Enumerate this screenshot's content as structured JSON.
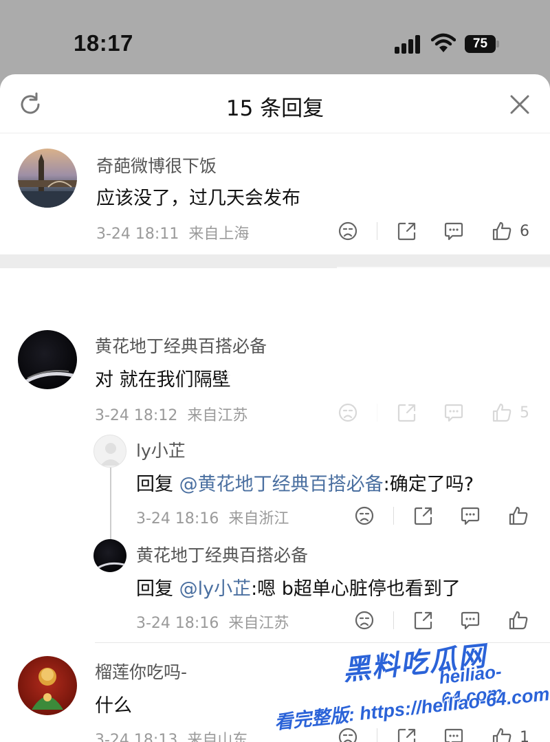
{
  "status_bar": {
    "time": "18:17",
    "battery": "75"
  },
  "sheet": {
    "title": "15 条回复"
  },
  "comments": [
    {
      "name": "奇葩微博很下饭",
      "text": "应该没了，过几天会发布",
      "time": "3-24 18:11",
      "location": "来自上海",
      "likes": "6"
    },
    {
      "name": "黄花地丁经典百搭必备",
      "text": "对 就在我们隔壁",
      "time": "3-24 18:12",
      "location": "来自江苏",
      "likes": "5"
    },
    {
      "name": "榴莲你吃吗-",
      "text": "什么",
      "time": "3-24 18:13",
      "location": "来自山东",
      "likes": "1"
    }
  ],
  "replies": [
    {
      "name": "ly小芷",
      "prefix": "回复",
      "mention": "@黄花地丁经典百搭必备",
      "text": ":确定了吗?",
      "time": "3-24 18:16",
      "location": "来自浙江"
    },
    {
      "name": "黄花地丁经典百搭必备",
      "prefix": "回复",
      "mention": "@ly小芷",
      "text": ":嗯 b超单心脏停也看到了",
      "time": "3-24 18:16",
      "location": "来自江苏"
    }
  ],
  "watermark": {
    "brand": "黑料吃瓜网",
    "domain": "heiliao-64.com",
    "line": "看完整版: https://heiliao-64.com"
  },
  "colors": {
    "mention": "#4a6fa0",
    "watermark": "#2b63d8"
  }
}
